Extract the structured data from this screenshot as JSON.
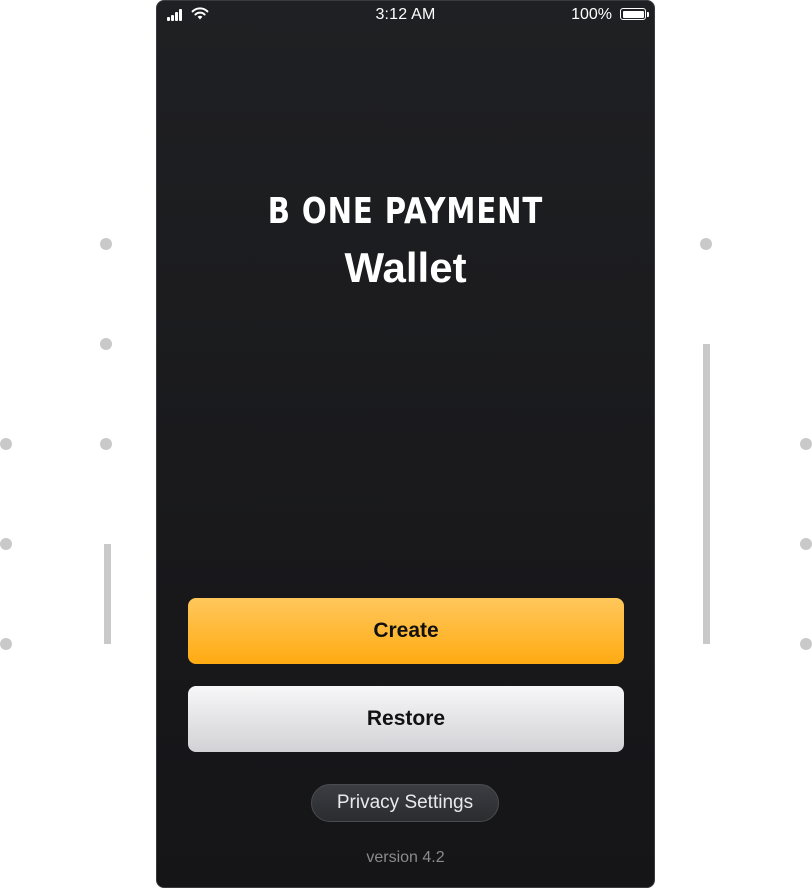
{
  "status_bar": {
    "time": "3:12 AM",
    "battery_percent": "100%",
    "signal_icon": "cellular-signal-icon",
    "wifi_icon": "wifi-icon",
    "battery_icon": "battery-icon"
  },
  "header": {
    "brand": "B ONE PAYMENT",
    "title": "Wallet"
  },
  "actions": {
    "create_label": "Create",
    "restore_label": "Restore",
    "privacy_label": "Privacy Settings"
  },
  "footer": {
    "version": "version 4.2"
  },
  "colors": {
    "background": "#1c1c1f",
    "create_button": "#ffb626",
    "restore_button": "#e6e6e9",
    "privacy_button": "#34353a",
    "decor": "#c9c9c9"
  }
}
